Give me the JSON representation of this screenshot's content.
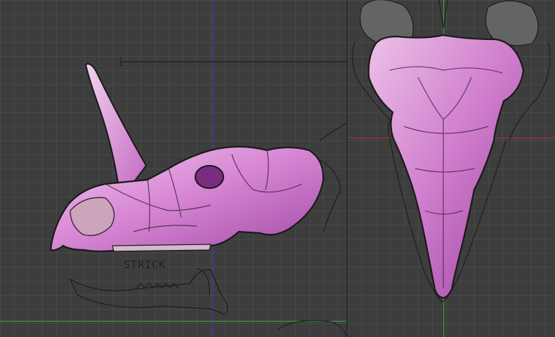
{
  "left_viewport": {
    "sketch_text": "STRICK"
  },
  "colors": {
    "background": "#3d3d3d",
    "grid": "rgba(255,255,255,0.055)",
    "axis_x": "#b83030",
    "axis_y": "#3aa83a",
    "axis_z": "#2f3fd0",
    "mesh": "#c86ac8",
    "mesh_light": "#e6b4e0",
    "sketch_lines": "#1a1a1a"
  }
}
